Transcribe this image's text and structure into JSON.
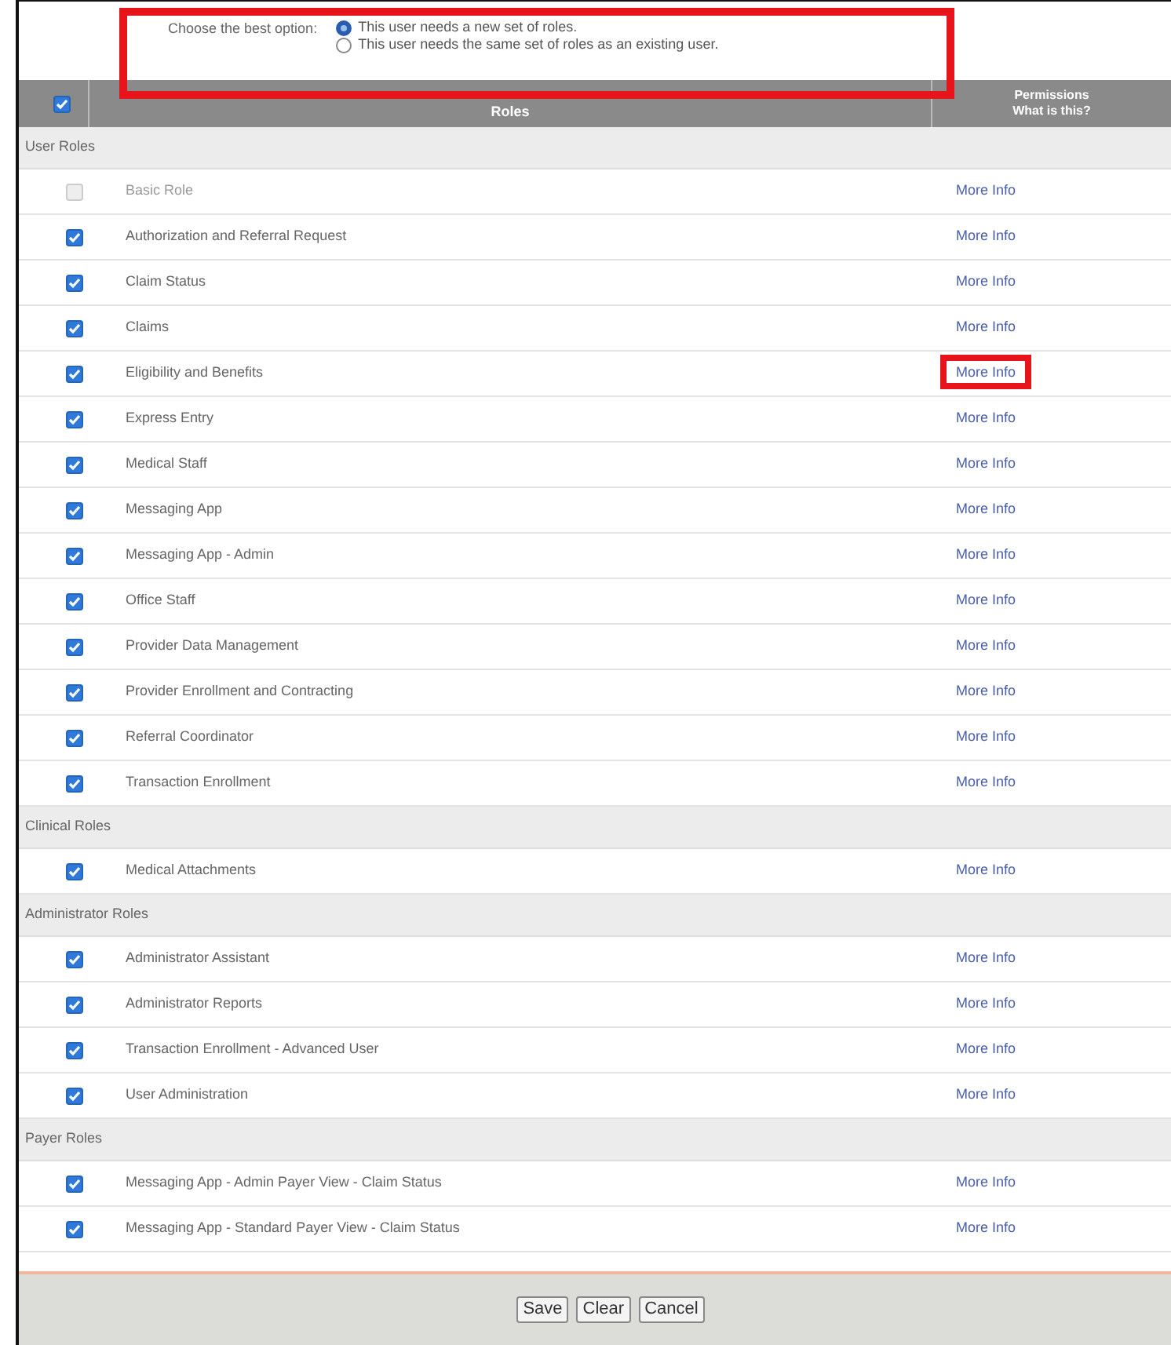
{
  "question": {
    "label": "Choose the best option:",
    "highlighted": true,
    "options": [
      {
        "label": "This user needs a new set of roles.",
        "selected": true
      },
      {
        "label": "This user needs the same set of roles as an existing user.",
        "selected": false
      }
    ]
  },
  "table": {
    "all_checked": true,
    "column_2": "Roles",
    "column_3": "Permissions",
    "column_3_link": "What is this?"
  },
  "groups": [
    {
      "title": "User Roles",
      "roles": [
        {
          "name": "Basic Role",
          "checked": false,
          "disabled": true,
          "link": "More Info",
          "highlighted": false
        },
        {
          "name": "Authorization and Referral Request",
          "checked": true,
          "disabled": false,
          "link": "More Info",
          "highlighted": false
        },
        {
          "name": "Claim Status",
          "checked": true,
          "disabled": false,
          "link": "More Info",
          "highlighted": false
        },
        {
          "name": "Claims",
          "checked": true,
          "disabled": false,
          "link": "More Info",
          "highlighted": false
        },
        {
          "name": "Eligibility and Benefits",
          "checked": true,
          "disabled": false,
          "link": "More Info",
          "highlighted": true
        },
        {
          "name": "Express Entry",
          "checked": true,
          "disabled": false,
          "link": "More Info",
          "highlighted": false
        },
        {
          "name": "Medical Staff",
          "checked": true,
          "disabled": false,
          "link": "More Info",
          "highlighted": false
        },
        {
          "name": "Messaging App",
          "checked": true,
          "disabled": false,
          "link": "More Info",
          "highlighted": false
        },
        {
          "name": "Messaging App - Admin",
          "checked": true,
          "disabled": false,
          "link": "More Info",
          "highlighted": false
        },
        {
          "name": "Office Staff",
          "checked": true,
          "disabled": false,
          "link": "More Info",
          "highlighted": false
        },
        {
          "name": "Provider Data Management",
          "checked": true,
          "disabled": false,
          "link": "More Info",
          "highlighted": false
        },
        {
          "name": "Provider Enrollment and Contracting",
          "checked": true,
          "disabled": false,
          "link": "More Info",
          "highlighted": false
        },
        {
          "name": "Referral Coordinator",
          "checked": true,
          "disabled": false,
          "link": "More Info",
          "highlighted": false
        },
        {
          "name": "Transaction Enrollment",
          "checked": true,
          "disabled": false,
          "link": "More Info",
          "highlighted": false
        }
      ]
    },
    {
      "title": "Clinical Roles",
      "roles": [
        {
          "name": "Medical Attachments",
          "checked": true,
          "disabled": false,
          "link": "More Info",
          "highlighted": false
        }
      ]
    },
    {
      "title": "Administrator Roles",
      "roles": [
        {
          "name": "Administrator Assistant",
          "checked": true,
          "disabled": false,
          "link": "More Info",
          "highlighted": false
        },
        {
          "name": "Administrator Reports",
          "checked": true,
          "disabled": false,
          "link": "More Info",
          "highlighted": false
        },
        {
          "name": "Transaction Enrollment - Advanced User",
          "checked": true,
          "disabled": false,
          "link": "More Info",
          "highlighted": false
        },
        {
          "name": "User Administration",
          "checked": true,
          "disabled": false,
          "link": "More Info",
          "highlighted": false
        }
      ]
    },
    {
      "title": "Payer Roles",
      "roles": [
        {
          "name": "Messaging App - Admin Payer View - Claim Status",
          "checked": true,
          "disabled": false,
          "link": "More Info",
          "highlighted": false
        },
        {
          "name": "Messaging App - Standard Payer View - Claim Status",
          "checked": true,
          "disabled": false,
          "link": "More Info",
          "highlighted": false
        }
      ]
    }
  ],
  "buttons": [
    "Save",
    "Clear",
    "Cancel"
  ]
}
